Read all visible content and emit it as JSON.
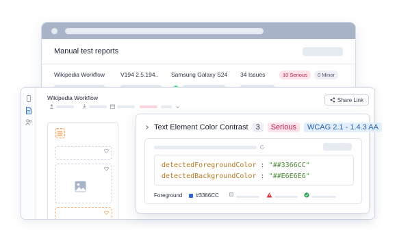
{
  "report_window": {
    "title": "Manual test reports",
    "row": {
      "workflow": "Wikipedia Workflow",
      "version": "V194 2.5.194..",
      "device": "Samsung Galaxy S24",
      "issues": "34 Issues",
      "serious_badge": "10 Serious",
      "minor_badge": "0 Minor"
    }
  },
  "detail_panel": {
    "title": "Wikipedia Workflow",
    "share_label": "Share Link"
  },
  "issue_card": {
    "title": "Text Element Color Contrast",
    "count": "3",
    "severity": "Serious",
    "guideline": "WCAG 2.1 - 1.4.3 AA",
    "code_lines": [
      {
        "key": "detectedForegroundColor",
        "sep": " : ",
        "value": "\"##3366CC\""
      },
      {
        "key": "detectedBackgroundColor",
        "sep": " : ",
        "value": "\"##E6E6E6\""
      }
    ],
    "legend": {
      "label": "Foreground",
      "value": "#3366CC"
    }
  },
  "colors": {
    "foreground": "#3366CC",
    "background": "#E6E6E6",
    "serious": "#b0204f",
    "wcag": "#1f5fae",
    "accent_orange": "#f5a35b"
  }
}
